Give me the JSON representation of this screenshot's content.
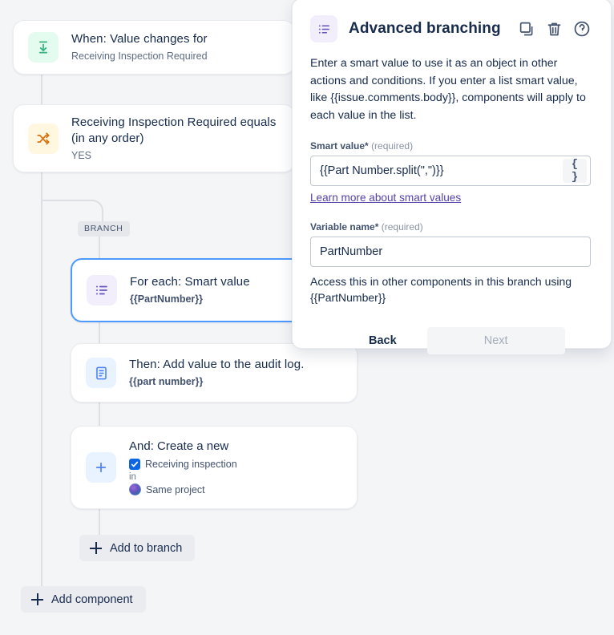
{
  "canvas": {
    "branch_pill": "BRANCH",
    "add_to_branch": "Add to branch",
    "add_component": "Add component"
  },
  "cards": [
    {
      "icon": "value-changes-icon",
      "title": "When: Value changes for",
      "sub": "Receiving Inspection Required"
    },
    {
      "icon": "shuffle-icon",
      "title": "Receiving Inspection Required equals (in any order)",
      "sub": "YES"
    },
    {
      "icon": "list-icon",
      "title": "For each: Smart value",
      "sub": "{{PartNumber}}"
    },
    {
      "icon": "audit-log-icon",
      "title": "Then: Add value to the audit log.",
      "sub": "{{part number}}"
    }
  ],
  "create_card": {
    "icon": "plus-icon",
    "title": "And: Create a new",
    "issue_type": "Receiving inspection",
    "connector_word": "in",
    "project": "Same project"
  },
  "modal": {
    "icon": "list-icon",
    "title": "Advanced branching",
    "actions": [
      {
        "name": "duplicate-icon"
      },
      {
        "name": "delete-icon"
      },
      {
        "name": "help-icon"
      }
    ],
    "description": "Enter a smart value to use it as an object in other actions and conditions. If you enter a list smart value, like {{issue.comments.body}}, components will apply to each value in the list.",
    "smart_value": {
      "label": "Smart value",
      "required_marker": "*",
      "required_text": "(required)",
      "value": "{{Part Number.split(\",\")}}",
      "placeholder": "",
      "brace_button": "{ }"
    },
    "learn_link": "Learn more about smart values",
    "variable_name": {
      "label": "Variable name",
      "required_marker": "*",
      "required_text": "(required)",
      "value": "PartNumber",
      "placeholder": ""
    },
    "help_text": "Access this in other components in this branch using {{PartNumber}}",
    "back_label": "Back",
    "next_label": "Next"
  },
  "colors": {
    "accent_blue": "#4c9aff",
    "link_purple": "#5243aa",
    "text_primary": "#172b4d",
    "text_muted": "#5e6c84"
  }
}
